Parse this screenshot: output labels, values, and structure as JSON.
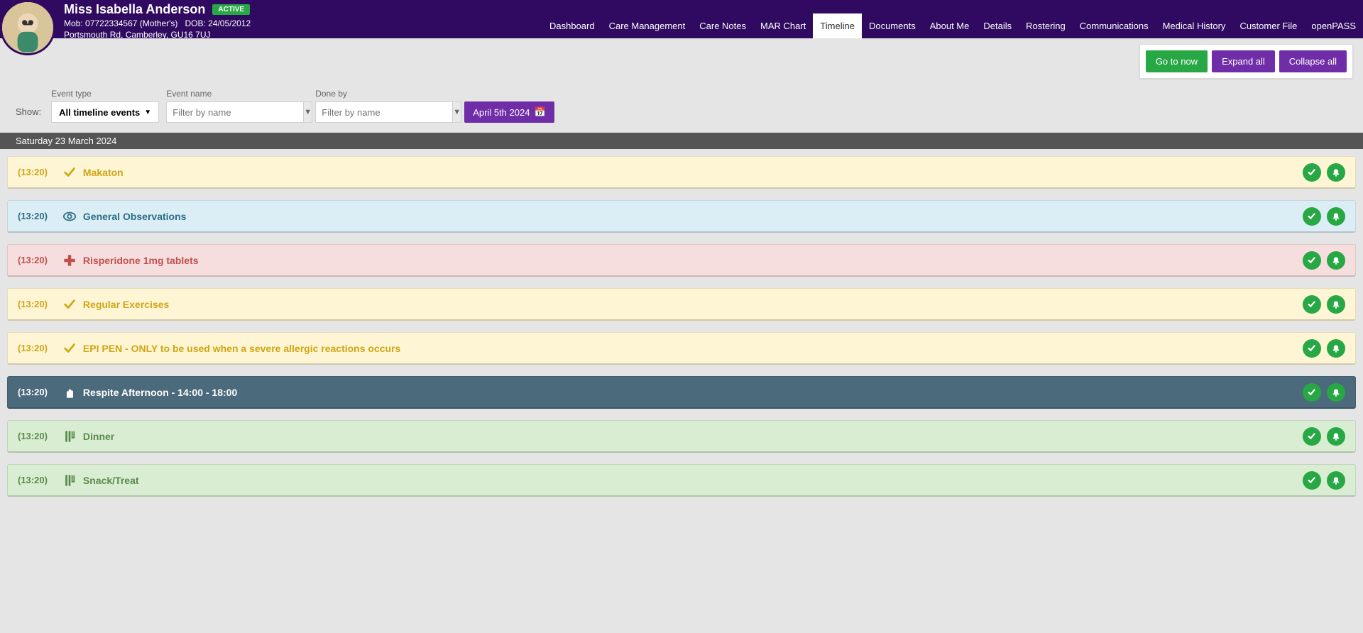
{
  "header": {
    "name": "Miss Isabella Anderson",
    "status": "ACTIVE",
    "line1_mob_label": "Mob:",
    "line1_mob": "07722334567 (Mother's)",
    "line1_dob_label": "DOB:",
    "line1_dob": "24/05/2012",
    "line2": "Portsmouth Rd, Camberley, GU16 7UJ"
  },
  "tabs": [
    {
      "label": "Dashboard"
    },
    {
      "label": "Care Management"
    },
    {
      "label": "Care Notes"
    },
    {
      "label": "MAR Chart"
    },
    {
      "label": "Timeline",
      "active": true
    },
    {
      "label": "Documents"
    },
    {
      "label": "About Me"
    },
    {
      "label": "Details"
    },
    {
      "label": "Rostering"
    },
    {
      "label": "Communications"
    },
    {
      "label": "Medical History"
    },
    {
      "label": "Customer File"
    },
    {
      "label": "openPASS"
    }
  ],
  "actions": {
    "go_to_now": "Go to now",
    "expand_all": "Expand all",
    "collapse_all": "Collapse all"
  },
  "filters": {
    "show_label": "Show:",
    "event_type_label": "Event type",
    "event_type_value": "All timeline events",
    "event_name_label": "Event name",
    "event_name_placeholder": "Filter by name",
    "done_by_label": "Done by",
    "done_by_placeholder": "Filter by name",
    "date_value": "April 5th 2024"
  },
  "date_separator": "Saturday 23 March 2024",
  "rows": [
    {
      "time": "(13:20)",
      "title": "Makaton",
      "theme": "yellow",
      "icon": "check"
    },
    {
      "time": "(13:20)",
      "title": "General Observations",
      "theme": "blue",
      "icon": "eye"
    },
    {
      "time": "(13:20)",
      "title": "Risperidone 1mg tablets",
      "theme": "pink",
      "icon": "plus"
    },
    {
      "time": "(13:20)",
      "title": "Regular Exercises",
      "theme": "yellow",
      "icon": "check"
    },
    {
      "time": "(13:20)",
      "title": "EPI PEN - ONLY to be used when a severe allergic reactions occurs",
      "theme": "yellow",
      "icon": "check"
    },
    {
      "time": "(13:20)",
      "title": "Respite Afternoon - 14:00 - 18:00",
      "theme": "dark",
      "icon": "hand"
    },
    {
      "time": "(13:20)",
      "title": "Dinner",
      "theme": "green",
      "icon": "food"
    },
    {
      "time": "(13:20)",
      "title": "Snack/Treat",
      "theme": "green",
      "icon": "food"
    }
  ]
}
